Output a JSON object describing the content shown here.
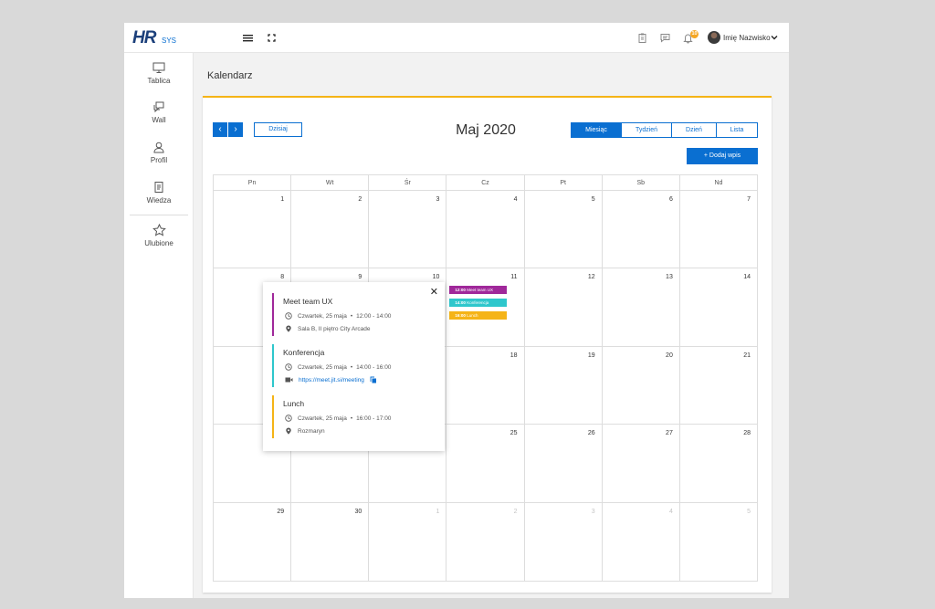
{
  "app": {
    "logo": {
      "main": "HR",
      "sub": "SYS"
    },
    "topbar": {
      "notifications_count": "10",
      "user_name": "Imię Nazwisko"
    }
  },
  "sidebar": {
    "items": [
      {
        "label": "Tablica",
        "icon": "monitor-icon"
      },
      {
        "label": "Wall",
        "icon": "chat-icon"
      },
      {
        "label": "Profil",
        "icon": "user-icon"
      },
      {
        "label": "Wiedza",
        "icon": "document-icon"
      },
      {
        "label": "Ulubione",
        "icon": "star-icon"
      }
    ]
  },
  "page": {
    "title": "Kalendarz"
  },
  "calendar": {
    "today_label": "Dzisiaj",
    "prev_label": "‹",
    "next_label": "›",
    "month_title": "Maj 2020",
    "views": [
      "Miesiąc",
      "Tydzień",
      "Dzień",
      "Lista"
    ],
    "active_view": "Miesiąc",
    "add_label": "+ Dodaj wpis",
    "weekdays": [
      "Pn",
      "Wt",
      "Śr",
      "Cz",
      "Pt",
      "Sb",
      "Nd"
    ],
    "weeks": [
      [
        "1",
        "2",
        "3",
        "4",
        "5",
        "6",
        "7"
      ],
      [
        "8",
        "9",
        "10",
        "11",
        "12",
        "13",
        "14"
      ],
      [
        "",
        "",
        "",
        "18",
        "19",
        "20",
        "21"
      ],
      [
        "",
        "",
        "",
        "25",
        "26",
        "27",
        "28"
      ],
      [
        "29",
        "30",
        "1",
        "2",
        "3",
        "4",
        "5"
      ]
    ],
    "chips": [
      {
        "time": "12:00",
        "title": "Meet team UX",
        "color": "#a0289a"
      },
      {
        "time": "14:00",
        "title": "Konferencja",
        "color": "#2ec7cc"
      },
      {
        "time": "16:00",
        "title": "Lunch",
        "color": "#f5b417"
      }
    ]
  },
  "popover": {
    "events": [
      {
        "title": "Meet team UX",
        "date": "Czwartek, 25 maja",
        "time": "12:00 - 14:00",
        "location": "Sala B, II piętro City Arcade",
        "color": "#a0289a"
      },
      {
        "title": "Konferencja",
        "date": "Czwartek, 25 maja",
        "time": "14:00 - 16:00",
        "link": "https://meet.jit.si/meeting",
        "color": "#2ec7cc"
      },
      {
        "title": "Lunch",
        "date": "Czwartek, 25 maja",
        "time": "16:00 - 17:00",
        "location": "Rozmaryn",
        "color": "#f5b417"
      }
    ]
  },
  "colors": {
    "accent": "#0a6fd1",
    "card_border": "#f5b417",
    "badge": "#f5a623"
  }
}
